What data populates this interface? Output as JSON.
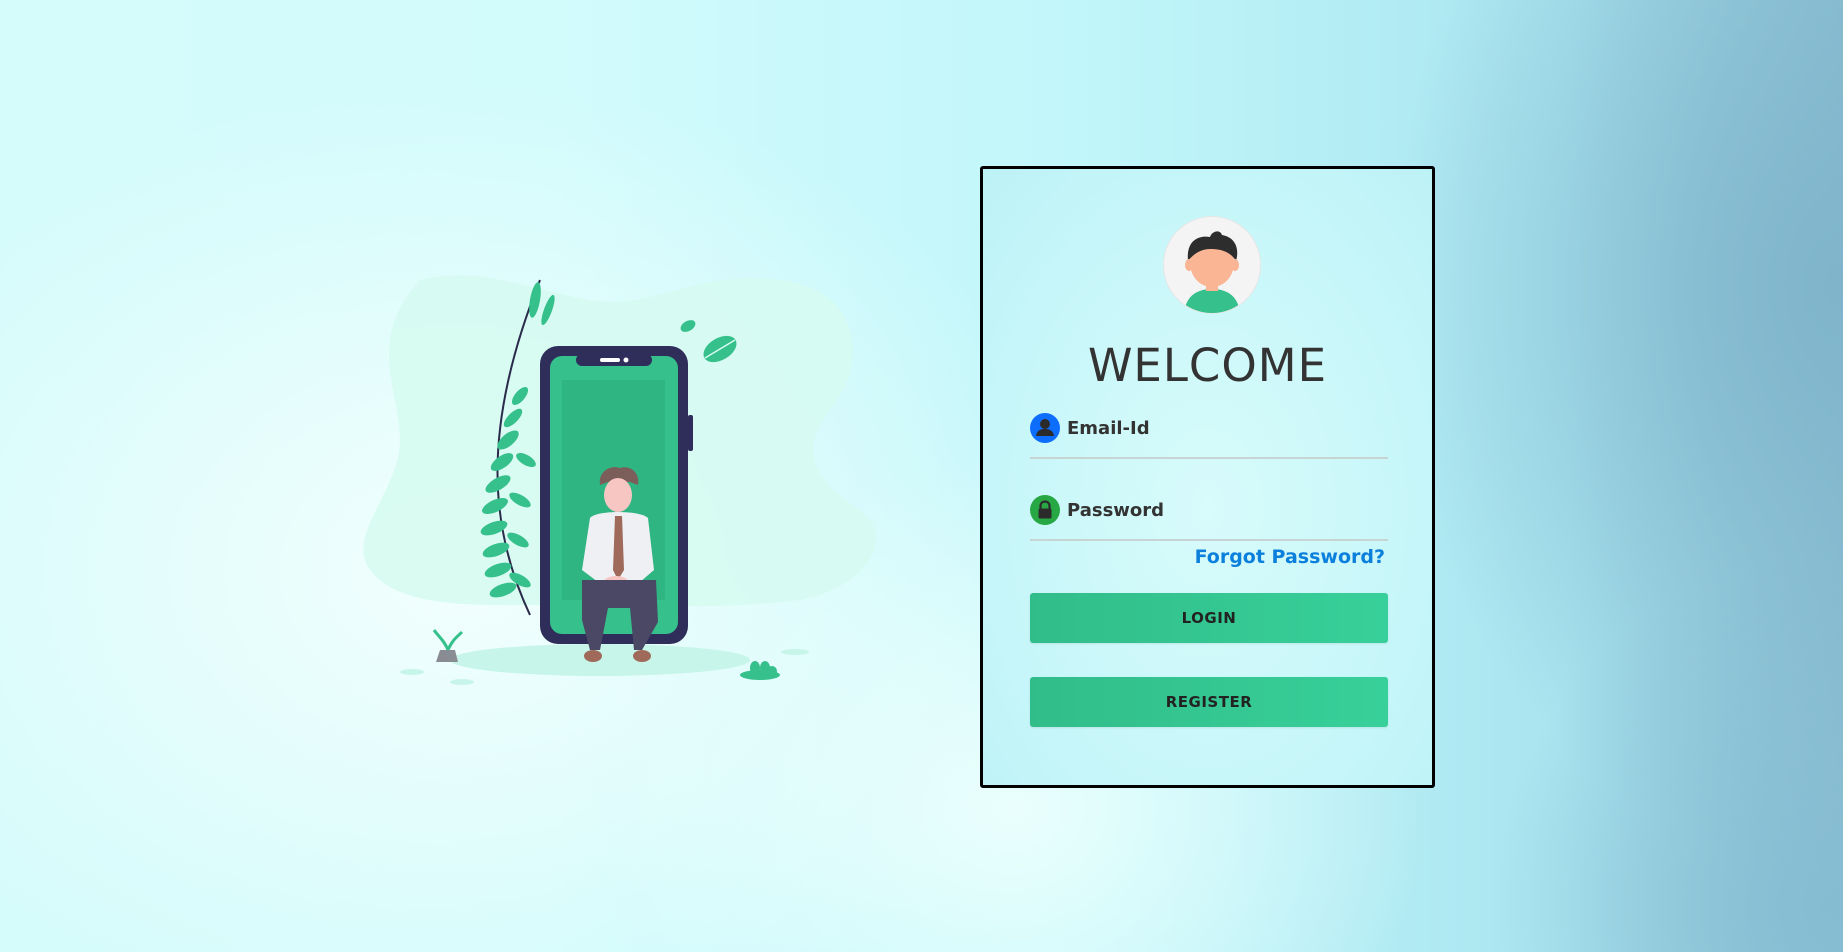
{
  "login_card": {
    "title": "WELCOME",
    "email_field": {
      "placeholder": "Email-Id",
      "value": ""
    },
    "password_field": {
      "placeholder": "Password",
      "value": ""
    },
    "forgot_password_link": "Forgot Password?",
    "login_button": "LOGIN",
    "register_button": "REGISTER"
  },
  "icons": {
    "avatar": "user-avatar-icon",
    "email": "user-icon",
    "password": "lock-icon"
  },
  "colors": {
    "accent_green": "#34c793",
    "link_blue": "#0a7fdb",
    "email_icon_bg": "#0d6efd",
    "password_icon_bg": "#28a745",
    "heading_text": "#333333"
  }
}
